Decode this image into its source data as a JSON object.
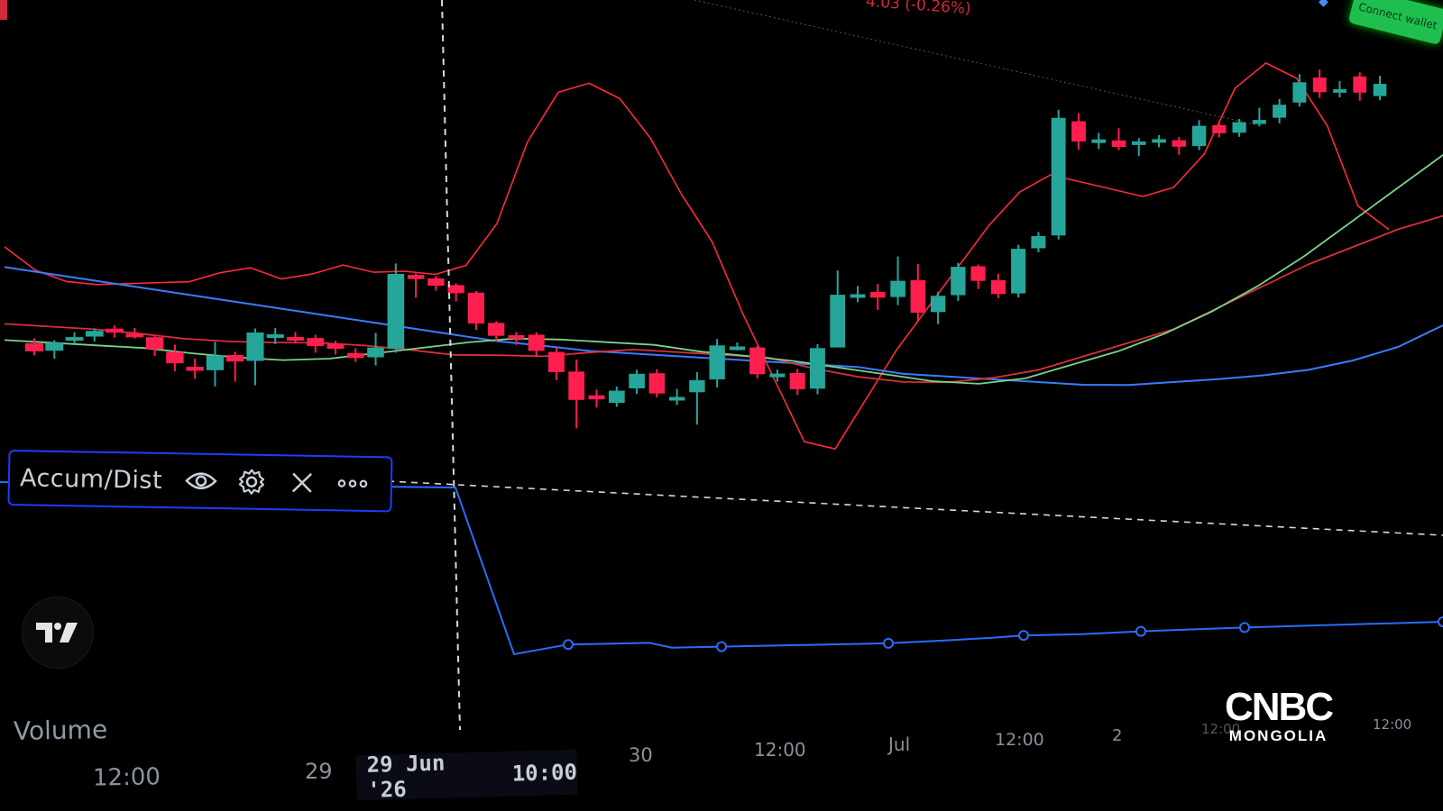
{
  "header": {
    "price_change": "4.03 (-0.26%)",
    "connect_wallet_label": "Connect wallet"
  },
  "indicator": {
    "name": "Accum/Dist",
    "actions": [
      "visibility-toggle",
      "settings",
      "remove",
      "more-options"
    ]
  },
  "volume_label": "Volume",
  "cursor": {
    "date": "29 Jun '26",
    "time": "10:00"
  },
  "time_axis": {
    "labels": [
      "12:00",
      "29",
      "30",
      "12:00",
      "Jul",
      "12:00",
      "2",
      "12:00",
      "12:00"
    ]
  },
  "brand": {
    "top": "CNBC",
    "bottom": "MONGOLIA"
  },
  "colors": {
    "up": "#26a69a",
    "down": "#ff1e4d",
    "upper_band": "#ff2a3a",
    "ma_red": "#d9303a",
    "ma_green": "#7ad38a",
    "ma_blue": "#3a7bff",
    "ad_line": "#2b6bff"
  },
  "chart_data": {
    "type": "candlestick",
    "description_series": [
      "price candles",
      "upper band",
      "red moving average",
      "green moving average",
      "blue moving average",
      "Accum/Dist"
    ],
    "candles": [
      {
        "o": 0.3,
        "c": 0.2,
        "h": 0.36,
        "l": 0.15
      },
      {
        "o": 0.2,
        "c": 0.3,
        "h": 0.33,
        "l": 0.1
      },
      {
        "o": 0.32,
        "c": 0.36,
        "h": 0.42,
        "l": 0.28
      },
      {
        "o": 0.36,
        "c": 0.43,
        "h": 0.46,
        "l": 0.3
      },
      {
        "o": 0.45,
        "c": 0.4,
        "h": 0.49,
        "l": 0.34
      },
      {
        "o": 0.38,
        "c": 0.35,
        "h": 0.45,
        "l": 0.32
      },
      {
        "o": 0.33,
        "c": 0.18,
        "h": 0.36,
        "l": 0.1
      },
      {
        "o": 0.14,
        "c": 0.0,
        "h": 0.23,
        "l": -0.1
      },
      {
        "o": -0.05,
        "c": -0.1,
        "h": 0.05,
        "l": -0.2
      },
      {
        "o": -0.1,
        "c": 0.08,
        "h": 0.25,
        "l": -0.3
      },
      {
        "o": 0.08,
        "c": 0.0,
        "h": 0.12,
        "l": -0.25
      },
      {
        "o": 0.0,
        "c": 0.35,
        "h": 0.4,
        "l": -0.3
      },
      {
        "o": 0.32,
        "c": 0.32,
        "h": 0.4,
        "l": 0.2
      },
      {
        "o": 0.28,
        "c": 0.25,
        "h": 0.34,
        "l": 0.2
      },
      {
        "o": 0.26,
        "c": 0.16,
        "h": 0.3,
        "l": 0.08
      },
      {
        "o": 0.18,
        "c": 0.12,
        "h": 0.22,
        "l": 0.05
      },
      {
        "o": 0.06,
        "c": 0.0,
        "h": 0.12,
        "l": -0.05
      },
      {
        "o": 0.0,
        "c": 0.12,
        "h": 0.3,
        "l": -0.1
      },
      {
        "o": 0.1,
        "c": 1.02,
        "h": 1.15,
        "l": 0.05
      },
      {
        "o": 1.0,
        "c": 0.95,
        "h": 1.02,
        "l": 0.72
      },
      {
        "o": 0.95,
        "c": 0.86,
        "h": 0.98,
        "l": 0.8
      },
      {
        "o": 0.86,
        "c": 0.76,
        "h": 0.88,
        "l": 0.66
      },
      {
        "o": 0.76,
        "c": 0.38,
        "h": 0.78,
        "l": 0.3
      },
      {
        "o": 0.38,
        "c": 0.22,
        "h": 0.4,
        "l": 0.15
      },
      {
        "o": 0.22,
        "c": 0.2,
        "h": 0.26,
        "l": 0.1
      },
      {
        "o": 0.22,
        "c": 0.02,
        "h": 0.25,
        "l": -0.05
      },
      {
        "o": 0.0,
        "c": -0.25,
        "h": 0.05,
        "l": -0.35
      },
      {
        "o": -0.25,
        "c": -0.6,
        "h": -0.1,
        "l": -0.95
      },
      {
        "o": -0.55,
        "c": -0.6,
        "h": -0.48,
        "l": -0.7
      },
      {
        "o": -0.65,
        "c": -0.5,
        "h": -0.45,
        "l": -0.7
      },
      {
        "o": -0.48,
        "c": -0.3,
        "h": -0.25,
        "l": -0.55
      },
      {
        "o": -0.3,
        "c": -0.55,
        "h": -0.25,
        "l": -0.6
      },
      {
        "o": -0.6,
        "c": -0.6,
        "h": -0.5,
        "l": -0.7
      },
      {
        "o": -0.55,
        "c": -0.4,
        "h": -0.3,
        "l": -0.95
      },
      {
        "o": -0.4,
        "c": 0.02,
        "h": 0.1,
        "l": -0.5
      },
      {
        "o": 0.0,
        "c": 0.0,
        "h": 0.05,
        "l": -0.05
      },
      {
        "o": -0.02,
        "c": -0.35,
        "h": 0.0,
        "l": -0.4
      },
      {
        "o": -0.35,
        "c": -0.35,
        "h": -0.3,
        "l": -0.45
      },
      {
        "o": -0.35,
        "c": -0.55,
        "h": -0.3,
        "l": -0.62
      },
      {
        "o": -0.55,
        "c": -0.05,
        "h": 0.0,
        "l": -0.62
      },
      {
        "o": -0.05,
        "c": 0.6,
        "h": 0.9,
        "l": -0.05
      },
      {
        "o": 0.6,
        "c": 0.6,
        "h": 0.7,
        "l": 0.5
      },
      {
        "o": 0.62,
        "c": 0.55,
        "h": 0.72,
        "l": 0.4
      },
      {
        "o": 0.55,
        "c": 0.75,
        "h": 1.05,
        "l": 0.45
      },
      {
        "o": 0.75,
        "c": 0.35,
        "h": 0.95,
        "l": 0.25
      },
      {
        "o": 0.35,
        "c": 0.55,
        "h": 0.6,
        "l": 0.2
      },
      {
        "o": 0.55,
        "c": 0.9,
        "h": 0.95,
        "l": 0.48
      },
      {
        "o": 0.9,
        "c": 0.72,
        "h": 0.92,
        "l": 0.62
      },
      {
        "o": 0.72,
        "c": 0.55,
        "h": 0.8,
        "l": 0.5
      },
      {
        "o": 0.55,
        "c": 1.1,
        "h": 1.15,
        "l": 0.5
      },
      {
        "o": 1.1,
        "c": 1.25,
        "h": 1.3,
        "l": 1.05
      },
      {
        "o": 1.25,
        "c": 2.7,
        "h": 2.8,
        "l": 1.2
      },
      {
        "o": 2.65,
        "c": 2.4,
        "h": 2.75,
        "l": 2.3
      },
      {
        "o": 2.4,
        "c": 2.42,
        "h": 2.5,
        "l": 2.3
      },
      {
        "o": 2.4,
        "c": 2.32,
        "h": 2.55,
        "l": 2.28
      },
      {
        "o": 2.35,
        "c": 2.38,
        "h": 2.42,
        "l": 2.2
      },
      {
        "o": 2.4,
        "c": 2.4,
        "h": 2.45,
        "l": 2.3
      },
      {
        "o": 2.38,
        "c": 2.3,
        "h": 2.42,
        "l": 2.2
      },
      {
        "o": 2.3,
        "c": 2.55,
        "h": 2.62,
        "l": 2.25
      },
      {
        "o": 2.55,
        "c": 2.45,
        "h": 2.6,
        "l": 2.4
      },
      {
        "o": 2.45,
        "c": 2.58,
        "h": 2.62,
        "l": 2.4
      },
      {
        "o": 2.55,
        "c": 2.6,
        "h": 2.75,
        "l": 2.52
      },
      {
        "o": 2.62,
        "c": 2.78,
        "h": 2.85,
        "l": 2.55
      },
      {
        "o": 2.8,
        "c": 3.05,
        "h": 3.15,
        "l": 2.75
      },
      {
        "o": 3.1,
        "c": 2.92,
        "h": 3.2,
        "l": 2.85
      },
      {
        "o": 2.92,
        "c": 2.95,
        "h": 3.05,
        "l": 2.85
      },
      {
        "o": 3.1,
        "c": 2.9,
        "h": 3.15,
        "l": 2.8
      },
      {
        "o": 2.85,
        "c": 3.0,
        "h": 3.1,
        "l": 2.8
      }
    ],
    "upper_band": [
      1.5,
      1.2,
      1.05,
      1.0,
      1.0,
      1.0,
      1.0,
      1.1,
      1.15,
      1.0,
      1.05,
      1.15,
      1.05,
      1.05,
      1.0,
      1.1,
      1.6,
      2.6,
      3.2,
      3.3,
      3.1,
      2.6,
      1.9,
      1.3,
      0.4,
      -0.4,
      -1.2,
      -1.3,
      -0.7,
      -0.1,
      0.4,
      0.9,
      1.4,
      1.8,
      2.0,
      1.9,
      1.8,
      1.7,
      1.8,
      2.2,
      3.0,
      3.3,
      3.1,
      2.5,
      1.5,
      1.2
    ],
    "ma_red": [
      0.55,
      0.5,
      0.45,
      0.38,
      0.3,
      0.25,
      0.22,
      0.2,
      0.15,
      0.08,
      0.0,
      -0.02,
      -0.05,
      -0.02,
      0.0,
      -0.05,
      -0.1,
      -0.15,
      -0.3,
      -0.42,
      -0.5,
      -0.52,
      -0.48,
      -0.4,
      -0.25,
      -0.1,
      0.05,
      0.3,
      0.55,
      0.8,
      1.0,
      1.2,
      1.35
    ],
    "ma_green": [
      0.35,
      0.3,
      0.25,
      0.2,
      0.12,
      0.05,
      0.0,
      0.0,
      0.05,
      0.1,
      0.15,
      0.18,
      0.15,
      0.1,
      0.05,
      -0.05,
      -0.12,
      -0.2,
      -0.3,
      -0.4,
      -0.5,
      -0.55,
      -0.5,
      -0.35,
      -0.2,
      0.0,
      0.25,
      0.55,
      0.9,
      1.3,
      1.7,
      2.1
    ],
    "ma_blue": [
      1.25,
      1.15,
      1.05,
      0.95,
      0.85,
      0.75,
      0.65,
      0.55,
      0.45,
      0.35,
      0.25,
      0.15,
      0.08,
      0.0,
      -0.05,
      -0.1,
      -0.15,
      -0.2,
      -0.25,
      -0.3,
      -0.4,
      -0.45,
      -0.5,
      -0.55,
      -0.6,
      -0.62,
      -0.6,
      -0.58,
      -0.55,
      -0.5,
      -0.4,
      -0.25,
      0.0
    ],
    "accum_dist": [
      0.0,
      0.0,
      0.0,
      0.0,
      -1.0,
      -0.95,
      -0.95,
      -0.95,
      -0.98,
      -0.98,
      -0.98,
      -0.98,
      -0.98,
      -0.97,
      -0.96,
      -0.95,
      -0.95,
      -0.94,
      -0.93,
      -0.92
    ]
  }
}
